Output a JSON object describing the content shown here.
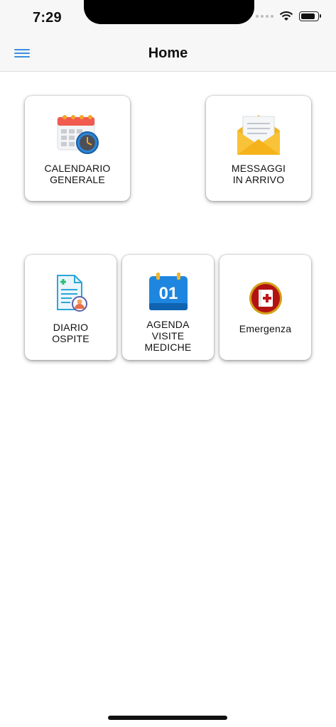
{
  "status": {
    "time": "7:29"
  },
  "navbar": {
    "title": "Home"
  },
  "tiles": [
    {
      "label": "CALENDARIO\nGENERALE",
      "icon": "calendar-clock-icon"
    },
    {
      "label": "MESSAGGI\nIN ARRIVO",
      "icon": "envelope-icon"
    },
    {
      "label": "DIARIO\nOSPITE",
      "icon": "medical-document-icon"
    },
    {
      "label": "AGENDA\nVISITE\nMEDICHE",
      "icon": "calendar-01-icon"
    },
    {
      "label": "Emergenza",
      "icon": "medical-book-icon"
    }
  ],
  "calendar_icon_day": "01"
}
